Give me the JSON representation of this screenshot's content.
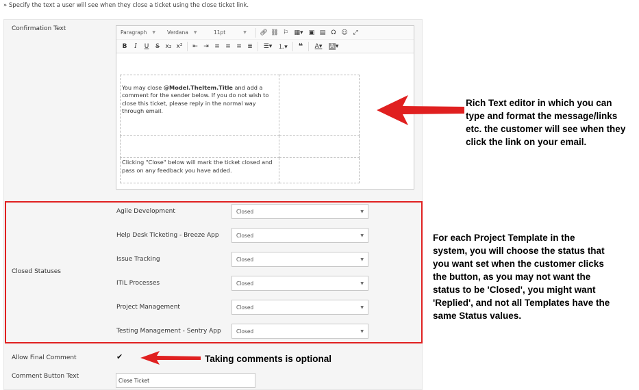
{
  "hint": "» Specify the text a user will see when they close a ticket using the close ticket link.",
  "confirmation": {
    "label": "Confirmation Text",
    "toolbar": {
      "paragraph": "Paragraph",
      "font": "Verdana",
      "size": "11pt",
      "buttons_row1": [
        "link-icon",
        "unlink-icon",
        "bookmark-icon",
        "table-icon",
        "image-icon",
        "media-icon",
        "special-char-icon",
        "emoticon-icon",
        "fullscreen-icon"
      ],
      "buttons_row2": [
        "bold",
        "italic",
        "underline",
        "strikethrough",
        "subscript",
        "superscript",
        "align-left",
        "align-center",
        "align-justify-left",
        "align-right",
        "justify",
        "bullet-list",
        "numbered-list",
        "blockquote",
        "font-color",
        "highlight-color"
      ]
    },
    "editor": {
      "cell1_pre": "You may close ",
      "cell1_bold": "@Model.TheItem.Title",
      "cell1_post": " and add a comment for the sender below. If you do not wish to close this ticket, please reply in the normal way through email.",
      "cell3": "Clicking \"Close\" below will mark the ticket closed and pass on any feedback you have added."
    }
  },
  "closed_statuses": {
    "label": "Closed Statuses",
    "rows": [
      {
        "name": "Agile Development",
        "value": "Closed"
      },
      {
        "name": "Help Desk Ticketing - Breeze App",
        "value": "Closed"
      },
      {
        "name": "Issue Tracking",
        "value": "Closed"
      },
      {
        "name": "ITIL Processes",
        "value": "Closed"
      },
      {
        "name": "Project Management",
        "value": "Closed"
      },
      {
        "name": "Testing Management - Sentry App",
        "value": "Closed"
      }
    ]
  },
  "allow_final_comment": {
    "label": "Allow Final Comment",
    "checked_glyph": "✔"
  },
  "comment_button": {
    "label": "Comment Button Text",
    "value": "Close Ticket"
  },
  "annotations": {
    "editor_note": "Rich Text editor in which you can type and format the message/links etc. the customer will see when they click the link on your email.",
    "statuses_note": "For each Project Template in the system, you will choose the status that you want set when the customer clicks the button, as you may not want the status to be 'Closed', you might want 'Replied', and not all Templates have the same Status values.",
    "comment_note": "Taking comments is optional"
  },
  "colors": {
    "annotation_red": "#e02020",
    "panel_bg": "#f5f5f5"
  }
}
